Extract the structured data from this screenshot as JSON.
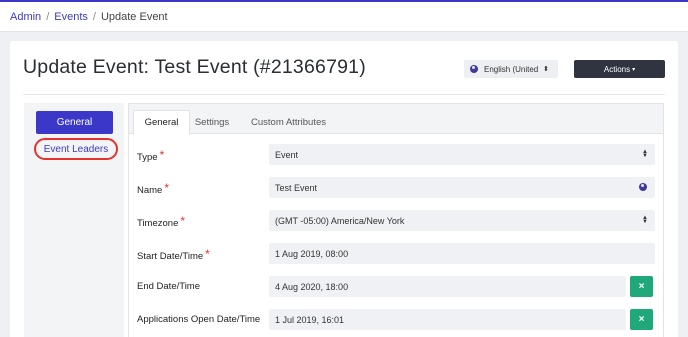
{
  "breadcrumb": [
    {
      "label": "Admin"
    },
    {
      "label": "Events"
    },
    {
      "label": "Update Event"
    }
  ],
  "breadcrumb_separator": "/",
  "page": {
    "title": "Update Event: Test Event (#21366791)"
  },
  "language_select": {
    "value": "English (United",
    "icon": "globe-icon"
  },
  "actions_button": {
    "label": "Actions",
    "caret": "▾"
  },
  "sidebar": {
    "items": [
      {
        "label": "General",
        "active": true
      },
      {
        "label": "Event Leaders",
        "active": false,
        "highlighted": true
      }
    ]
  },
  "tabs": [
    {
      "label": "General",
      "active": true
    },
    {
      "label": "Settings",
      "active": false
    },
    {
      "label": "Custom Attributes",
      "active": false
    }
  ],
  "form": {
    "rows": [
      {
        "label": "Type",
        "required": true,
        "value": "Event",
        "control": "select"
      },
      {
        "label": "Name",
        "required": true,
        "value": "Test Event",
        "control": "text-translatable"
      },
      {
        "label": "Timezone",
        "required": true,
        "value": "(GMT -05:00) America/New York",
        "control": "select"
      },
      {
        "label": "Start Date/Time",
        "required": true,
        "value": "1 Aug 2019, 08:00",
        "control": "datetime"
      },
      {
        "label": "End Date/Time",
        "required": false,
        "value": "4 Aug 2020, 18:00",
        "control": "datetime-clearable"
      },
      {
        "label": "Applications Open Date/Time",
        "required": false,
        "value": "1 Jul 2019, 16:01",
        "control": "datetime-clearable"
      }
    ],
    "required_marker": "*",
    "clear_glyph": "×"
  },
  "colors": {
    "accent": "#3b38c9",
    "required": "#e5312f",
    "clear_button": "#1fa97a",
    "actions_button": "#2f3440"
  }
}
